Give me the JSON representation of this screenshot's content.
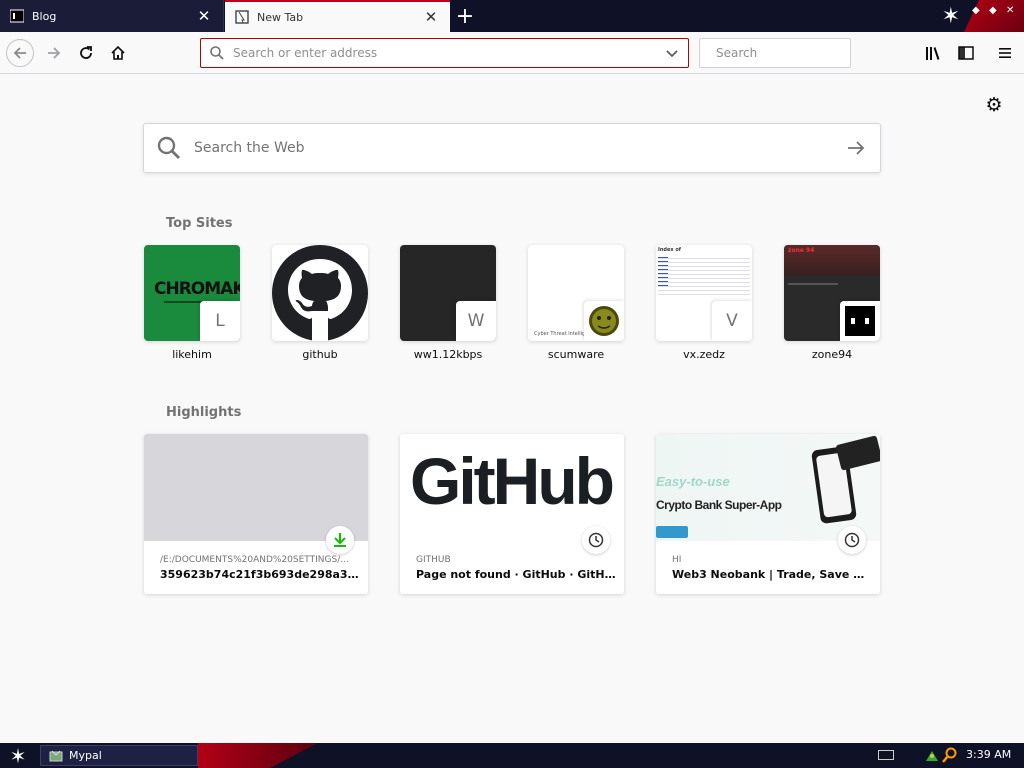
{
  "tabs": [
    {
      "label": "Blog",
      "active": false
    },
    {
      "label": "New Tab",
      "active": true
    }
  ],
  "navbar": {
    "url_placeholder": "Search or enter address",
    "search_placeholder": "Search"
  },
  "content": {
    "web_search_placeholder": "Search the Web",
    "top_sites_title": "Top Sites",
    "highlights_title": "Highlights",
    "top_sites": [
      {
        "label": "likehim",
        "letter": "L",
        "tile_text": "CHROMAK"
      },
      {
        "label": "github",
        "letter": ""
      },
      {
        "label": "ww1.12kbps",
        "letter": "W"
      },
      {
        "label": "scumware",
        "letter": "",
        "tile_text": "Cyber Threat Intellig"
      },
      {
        "label": "vx.zedz",
        "letter": "V",
        "tile_text": "Index of"
      },
      {
        "label": "zone94",
        "letter": "",
        "tile_text": "zone 94"
      }
    ],
    "highlights": [
      {
        "source": "/E:/DOCUMENTS%20AND%20SETTINGS/V...",
        "title": "359623b74c21f3b693de298a3c...",
        "badge": "download-icon"
      },
      {
        "source": "GITHUB",
        "title": "Page not found · GitHub · GitHub",
        "badge": "clock-icon",
        "image_text": "GitHub"
      },
      {
        "source": "HI",
        "title": "Web3 Neobank | Trade, Save & ...",
        "badge": "clock-icon",
        "image_text_1": "Easy-to-use",
        "image_text_2": "Crypto Bank Super-App"
      }
    ]
  },
  "taskbar": {
    "task_label": "Mypal",
    "clock": "3:39 AM"
  },
  "colors": {
    "tabstrip_bg": "#0f1126",
    "accent_red": "#c3001b",
    "github_tile": "#202124"
  }
}
